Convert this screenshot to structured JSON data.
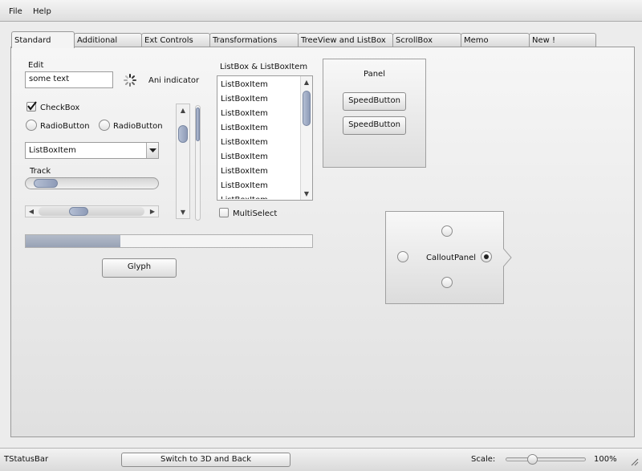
{
  "menu": {
    "file": "File",
    "help": "Help"
  },
  "tabs": [
    {
      "label": "Standard",
      "active": true
    },
    {
      "label": "Additional"
    },
    {
      "label": "Ext Controls"
    },
    {
      "label": "Transformations"
    },
    {
      "label": "TreeView and ListBox"
    },
    {
      "label": "ScrollBox"
    },
    {
      "label": "Memo"
    },
    {
      "label": "New !"
    }
  ],
  "edit": {
    "label": "Edit",
    "value": "some text"
  },
  "ani_indicator": {
    "label": "Ani indicator"
  },
  "checkbox": {
    "label": "CheckBox",
    "checked": true
  },
  "radios": [
    {
      "label": "RadioButton"
    },
    {
      "label": "RadioButton"
    }
  ],
  "combobox": {
    "selected": "ListBoxItem"
  },
  "track": {
    "label": "Track",
    "value_fraction": 0.07
  },
  "hscroll": {
    "position_fraction": 0.35
  },
  "vscroll": {
    "position_fraction": 0.12
  },
  "listbox": {
    "label": "ListBox & ListBoxItem",
    "items": [
      "ListBoxItem",
      "ListBoxItem",
      "ListBoxItem",
      "ListBoxItem",
      "ListBoxItem",
      "ListBoxItem",
      "ListBoxItem",
      "ListBoxItem",
      "ListBoxItem"
    ],
    "multiselect_label": "MultiSelect",
    "multiselect_checked": false
  },
  "progress": {
    "value_fraction": 0.33
  },
  "glyph_button": "Glyph",
  "panel": {
    "label": "Panel",
    "buttons": [
      "SpeedButton",
      "SpeedButton"
    ]
  },
  "callout": {
    "label": "CalloutPanel",
    "selected_radio": "right"
  },
  "statusbar": {
    "label": "TStatusBar",
    "switch_button": "Switch to 3D and Back",
    "scale_label": "Scale:",
    "scale_value": "100%",
    "scale_fraction": 0.3
  },
  "colors": {
    "accent_thumb": "#9aa6be",
    "progress_fill": "#a3acbd"
  }
}
